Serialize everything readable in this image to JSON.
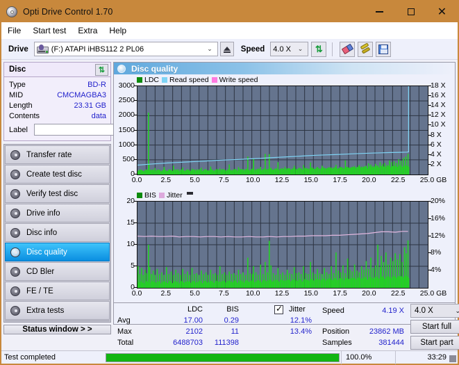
{
  "window": {
    "title": "Opti Drive Control 1.70",
    "icon": "disc-icon",
    "minimize": "–",
    "maximize": "□",
    "close": "✕"
  },
  "menu": {
    "items": [
      "File",
      "Start test",
      "Extra",
      "Help"
    ]
  },
  "toolbar": {
    "drive_label": "Drive",
    "drive_value": "(F:)  ATAPI iHBS112  2 PL06",
    "eject_icon": "eject-icon",
    "speed_label": "Speed",
    "speed_value": "4.0 X",
    "refresh_icon": "refresh-icon",
    "eraser_icon": "eraser-icon",
    "tools_icon": "tools-icon",
    "save_icon": "save-icon",
    "dropdown_arrow": "⌄"
  },
  "sidebar": {
    "disc_panel": {
      "title": "Disc",
      "refresh_icon": "refresh-icon",
      "rows": [
        {
          "label": "Type",
          "value": "BD-R"
        },
        {
          "label": "MID",
          "value": "CMCMAGBA3"
        },
        {
          "label": "Length",
          "value": "23.31 GB"
        },
        {
          "label": "Contents",
          "value": "data"
        }
      ],
      "label_field_label": "Label",
      "label_field_value": "",
      "label_button_icon": "disc-label-icon"
    },
    "nav_items": [
      {
        "label": "Transfer rate",
        "icon": "disc-icon",
        "active": false
      },
      {
        "label": "Create test disc",
        "icon": "disc-icon",
        "active": false
      },
      {
        "label": "Verify test disc",
        "icon": "disc-icon",
        "active": false
      },
      {
        "label": "Drive info",
        "icon": "disc-icon",
        "active": false
      },
      {
        "label": "Disc info",
        "icon": "disc-icon",
        "active": false
      },
      {
        "label": "Disc quality",
        "icon": "disc-icon",
        "active": true
      },
      {
        "label": "CD Bler",
        "icon": "disc-icon",
        "active": false
      },
      {
        "label": "FE / TE",
        "icon": "disc-icon",
        "active": false
      },
      {
        "label": "Extra tests",
        "icon": "disc-icon",
        "active": false
      }
    ],
    "status_window_button": "Status window > >"
  },
  "main": {
    "header_title": "Disc quality",
    "header_icon": "disc-icon"
  },
  "stats": {
    "col_ldc": "LDC",
    "col_bis": "BIS",
    "jitter_label": "Jitter",
    "jitter_checked": true,
    "row_avg": "Avg",
    "row_max": "Max",
    "row_total": "Total",
    "ldc_avg": "17.00",
    "ldc_max": "2102",
    "ldc_total": "6488703",
    "bis_avg": "0.29",
    "bis_max": "11",
    "bis_total": "111398",
    "jitter_avg": "12.1%",
    "jitter_max": "13.4%",
    "speed_label": "Speed",
    "speed_value": "4.19 X",
    "position_label": "Position",
    "position_value": "23862 MB",
    "samples_label": "Samples",
    "samples_value": "381444",
    "speed_select": "4.0 X",
    "dropdown_arrow": "⌄",
    "start_full": "Start full",
    "start_part": "Start part"
  },
  "statusbar": {
    "message": "Test completed",
    "progress_percent": "100.0%",
    "progress_value": 100,
    "elapsed": "33:29"
  },
  "colors": {
    "titlebar": "#c8883c",
    "plot_bg": "#65748e",
    "ldc_green": "#24d024",
    "read_speed": "#7fd4f5",
    "write_speed": "#ff7ae0",
    "bis_green": "#24d024",
    "jitter_pink": "#e3b8e0",
    "value_blue": "#2222cc",
    "progress_green": "#12b512",
    "accent_active": "#0a8ee0"
  },
  "chart_data": [
    {
      "type": "line",
      "id": "disc-quality-ldc-chart",
      "title": "",
      "xlabel": "GB",
      "ylabel": "LDC",
      "xlim": [
        0,
        25
      ],
      "xticks": [
        0.0,
        2.5,
        5.0,
        7.5,
        10.0,
        12.5,
        15.0,
        17.5,
        20.0,
        22.5,
        25.0
      ],
      "xticklabels": [
        "0.0",
        "2.5",
        "5.0",
        "7.5",
        "10.0",
        "12.5",
        "15.0",
        "17.5",
        "20.0",
        "22.5",
        "25.0 GB"
      ],
      "ylim": [
        0,
        3000
      ],
      "yticks": [
        0,
        500,
        1000,
        1500,
        2000,
        2500,
        3000
      ],
      "yticklabels": [
        "0",
        "500",
        "1000",
        "1500",
        "2000",
        "2500",
        "3000"
      ],
      "y2label": "Speed",
      "y2lim": [
        0,
        18
      ],
      "y2ticks": [
        2,
        4,
        6,
        8,
        10,
        12,
        14,
        16,
        18
      ],
      "y2ticklabels": [
        "2 X",
        "4 X",
        "6 X",
        "8 X",
        "10 X",
        "12 X",
        "14 X",
        "16 X",
        "18 X"
      ],
      "grid": true,
      "legend": [
        "LDC",
        "Read speed",
        "Write speed"
      ],
      "legend_position": "top-left",
      "series": [
        {
          "name": "LDC",
          "color": "#24d024",
          "kind": "impulse",
          "x": [
            0.05,
            0.2,
            0.35,
            0.5,
            0.65,
            0.8,
            0.95,
            1.0,
            1.15,
            1.3,
            1.5,
            1.7,
            1.9,
            2.1,
            2.3,
            2.5,
            2.7,
            2.9,
            3.1,
            3.3,
            3.5,
            3.7,
            3.9,
            4.1,
            4.3,
            4.5,
            4.7,
            4.9,
            5.1,
            5.3,
            5.5,
            5.7,
            5.9,
            6.1,
            6.3,
            6.5,
            6.7,
            6.9,
            7.1,
            7.3,
            7.5,
            7.7,
            7.9,
            8.1,
            8.3,
            8.5,
            8.7,
            8.9,
            9.1,
            9.3,
            9.5,
            9.7,
            9.9,
            10.0,
            10.2,
            10.4,
            10.6,
            10.8,
            11.0,
            11.2,
            11.35,
            11.5,
            11.7,
            11.9,
            12.1,
            12.3,
            12.5,
            12.7,
            12.9,
            13.1,
            13.3,
            13.5,
            13.7,
            13.9,
            14.1,
            14.3,
            14.5,
            14.7,
            14.9,
            15.1,
            15.3,
            15.5,
            15.7,
            15.9,
            16.1,
            16.3,
            16.5,
            16.7,
            16.9,
            17.1,
            17.3,
            17.5,
            17.7,
            17.9,
            18.1,
            18.3,
            18.5,
            18.7,
            18.9,
            19.1,
            19.3,
            19.5,
            19.7,
            19.9,
            20.1,
            20.3,
            20.5,
            20.7,
            20.9,
            21.1,
            21.3,
            21.5,
            21.7,
            21.9,
            22.1,
            22.3,
            22.5,
            22.7,
            22.9,
            23.1,
            23.3
          ],
          "y": [
            120,
            95,
            110,
            90,
            140,
            105,
            2102,
            380,
            160,
            125,
            220,
            130,
            150,
            110,
            260,
            120,
            170,
            135,
            300,
            115,
            180,
            130,
            240,
            125,
            150,
            118,
            200,
            140,
            175,
            120,
            230,
            135,
            160,
            128,
            270,
            122,
            145,
            132,
            210,
            118,
            155,
            126,
            340,
            130,
            165,
            120,
            250,
            138,
            180,
            124,
            610,
            142,
            200,
            520,
            175,
            130,
            260,
            145,
            700,
            180,
            690,
            230,
            165,
            140,
            420,
            175,
            150,
            260,
            168,
            210,
            155,
            300,
            175,
            225,
            180,
            320,
            165,
            200,
            410,
            240,
            185,
            260,
            175,
            300,
            190,
            210,
            165,
            240,
            180,
            330,
            190,
            250,
            220,
            480,
            260,
            230,
            210,
            290,
            245,
            320,
            270,
            250,
            300,
            380,
            340,
            290,
            360,
            310,
            420,
            350,
            390,
            330,
            480,
            420,
            450,
            390,
            520,
            470,
            560,
            610,
            700
          ]
        },
        {
          "name": "Read speed",
          "color": "#7fd4f5",
          "kind": "line",
          "x": [
            0.0,
            0.5,
            1.0,
            1.8,
            2.6,
            3.4,
            4.2,
            5.0,
            5.8,
            6.6,
            7.4,
            8.2,
            9.0,
            9.8,
            10.6,
            11.4,
            12.2,
            13.0,
            13.8,
            14.6,
            15.4,
            16.2,
            17.0,
            17.8,
            18.6,
            19.4,
            20.2,
            21.0,
            21.8,
            22.6,
            23.2,
            23.35,
            23.35
          ],
          "y": [
            1.92,
            2.0,
            2.1,
            2.22,
            2.35,
            2.45,
            2.55,
            2.65,
            2.75,
            2.85,
            2.95,
            3.02,
            3.1,
            3.2,
            3.3,
            3.42,
            3.52,
            3.62,
            3.72,
            3.82,
            3.92,
            4.0,
            4.06,
            4.14,
            4.22,
            4.3,
            4.36,
            4.42,
            4.48,
            4.52,
            4.56,
            4.6,
            18.0
          ],
          "axis": "right"
        },
        {
          "name": "Write speed",
          "color": "#ff7ae0",
          "kind": "line",
          "x": [],
          "y": [],
          "axis": "right"
        }
      ]
    },
    {
      "type": "line",
      "id": "disc-quality-bis-chart",
      "title": "",
      "xlabel": "GB",
      "ylabel": "BIS",
      "xlim": [
        0,
        25
      ],
      "xticks": [
        0.0,
        2.5,
        5.0,
        7.5,
        10.0,
        12.5,
        15.0,
        17.5,
        20.0,
        22.5,
        25.0
      ],
      "xticklabels": [
        "0.0",
        "2.5",
        "5.0",
        "7.5",
        "10.0",
        "12.5",
        "15.0",
        "17.5",
        "20.0",
        "22.5",
        "25.0 GB"
      ],
      "ylim": [
        0,
        20
      ],
      "yticks": [
        0,
        5,
        10,
        15,
        20
      ],
      "yticklabels": [
        "0",
        "5",
        "10",
        "15",
        "20"
      ],
      "y2label": "Jitter",
      "y2lim": [
        0,
        20
      ],
      "y2ticks": [
        4,
        8,
        12,
        16,
        20
      ],
      "y2ticklabels": [
        "4%",
        "8%",
        "12%",
        "16%",
        "20%"
      ],
      "grid": true,
      "legend": [
        "BIS",
        "Jitter"
      ],
      "legend_position": "top-left",
      "series": [
        {
          "name": "BIS",
          "color": "#24d024",
          "kind": "impulse",
          "x": [
            0.05,
            0.2,
            0.35,
            0.5,
            0.65,
            0.8,
            0.95,
            1.05,
            1.2,
            1.35,
            1.5,
            1.7,
            1.9,
            2.1,
            2.3,
            2.5,
            2.7,
            2.9,
            3.1,
            3.3,
            3.5,
            3.7,
            3.9,
            4.1,
            4.3,
            4.5,
            4.7,
            4.9,
            5.1,
            5.3,
            5.5,
            5.7,
            5.9,
            6.1,
            6.3,
            6.5,
            6.7,
            6.9,
            7.1,
            7.3,
            7.5,
            7.7,
            7.9,
            8.1,
            8.3,
            8.5,
            8.7,
            8.9,
            9.1,
            9.3,
            9.5,
            9.7,
            9.9,
            10.0,
            10.2,
            10.4,
            10.6,
            10.8,
            11.0,
            11.2,
            11.35,
            11.5,
            11.7,
            11.9,
            12.1,
            12.3,
            12.5,
            12.7,
            12.9,
            13.1,
            13.3,
            13.5,
            13.7,
            13.9,
            14.1,
            14.3,
            14.5,
            14.7,
            14.9,
            15.1,
            15.3,
            15.5,
            15.7,
            15.9,
            16.1,
            16.3,
            16.5,
            16.7,
            16.9,
            17.1,
            17.3,
            17.5,
            17.7,
            17.9,
            18.1,
            18.3,
            18.5,
            18.7,
            18.9,
            19.1,
            19.3,
            19.5,
            19.7,
            19.9,
            20.1,
            20.3,
            20.5,
            20.7,
            20.9,
            21.0,
            21.2,
            21.4,
            21.6,
            21.8,
            22.0,
            22.2,
            22.4,
            22.6,
            22.8,
            23.0,
            23.15,
            23.3
          ],
          "y": [
            5.0,
            3.2,
            4.6,
            3.0,
            4.2,
            3.4,
            10.0,
            4.8,
            3.2,
            4.0,
            3.0,
            4.4,
            3.2,
            3.6,
            3.0,
            4.8,
            3.2,
            3.8,
            3.0,
            4.2,
            3.4,
            3.0,
            4.4,
            3.2,
            3.8,
            3.0,
            4.6,
            3.2,
            3.4,
            3.0,
            4.0,
            3.2,
            3.6,
            3.0,
            4.2,
            3.2,
            3.4,
            3.0,
            5.0,
            3.2,
            3.6,
            3.0,
            3.8,
            3.2,
            3.4,
            3.0,
            4.2,
            3.2,
            3.6,
            3.0,
            7.0,
            3.4,
            3.2,
            5.0,
            3.6,
            3.0,
            5.4,
            3.2,
            6.0,
            3.6,
            10.9,
            5.2,
            3.4,
            3.0,
            4.6,
            3.2,
            3.6,
            3.0,
            4.2,
            3.4,
            3.2,
            4.8,
            3.4,
            3.6,
            3.2,
            5.0,
            3.4,
            3.2,
            6.0,
            3.6,
            3.2,
            4.4,
            3.4,
            3.2,
            4.6,
            3.6,
            3.2,
            5.0,
            3.4,
            8.2,
            4.0,
            3.6,
            5.2,
            3.4,
            6.8,
            4.2,
            3.8,
            5.4,
            4.0,
            3.6,
            5.0,
            4.2,
            6.2,
            4.4,
            7.0,
            4.6,
            5.2,
            10.0,
            4.8,
            7.4,
            6.0,
            8.2,
            5.4,
            7.0,
            6.2,
            8.0,
            6.6,
            7.8,
            6.0,
            9.4,
            8.0,
            11.0
          ]
        },
        {
          "name": "Jitter",
          "color": "#e3b8e0",
          "kind": "line",
          "x": [
            0.0,
            0.6,
            1.2,
            1.8,
            2.4,
            3.0,
            3.6,
            4.2,
            4.8,
            5.4,
            6.0,
            6.6,
            7.2,
            7.8,
            8.4,
            9.0,
            9.6,
            10.2,
            10.8,
            11.4,
            12.0,
            12.6,
            13.2,
            13.8,
            14.4,
            15.0,
            15.6,
            16.2,
            16.8,
            17.4,
            18.0,
            18.6,
            19.2,
            19.8,
            20.4,
            21.0,
            21.6,
            22.2,
            22.8,
            23.3
          ],
          "y": [
            12.0,
            11.9,
            12.0,
            11.9,
            11.9,
            12.0,
            11.8,
            11.9,
            11.9,
            11.8,
            11.9,
            11.9,
            11.8,
            11.9,
            11.8,
            11.8,
            11.9,
            11.8,
            11.8,
            11.9,
            11.8,
            11.9,
            11.9,
            12.0,
            12.0,
            12.1,
            12.1,
            12.1,
            12.2,
            12.2,
            12.3,
            12.4,
            12.5,
            12.6,
            12.8,
            13.0,
            13.0,
            12.9,
            13.1,
            13.1
          ],
          "axis": "right"
        }
      ]
    }
  ]
}
